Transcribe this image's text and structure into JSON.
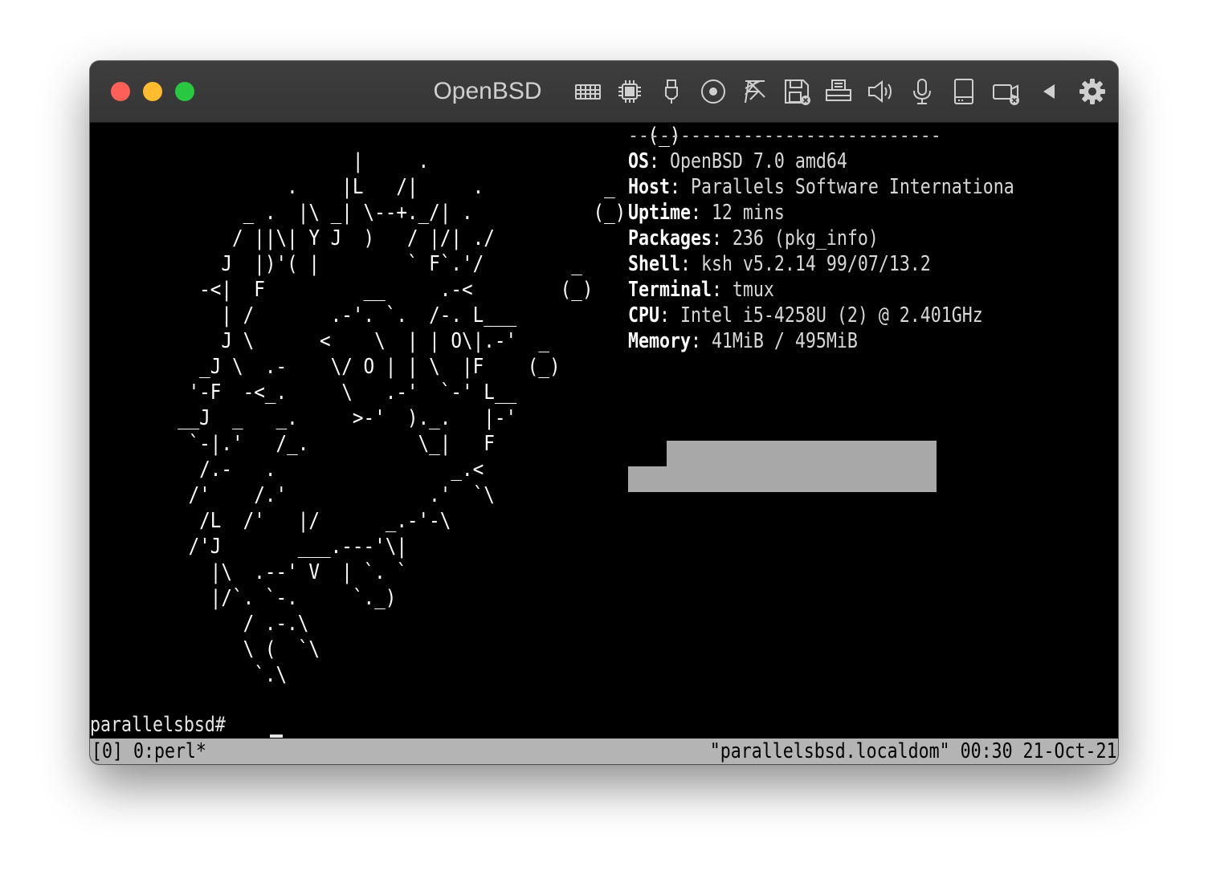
{
  "window": {
    "title": "OpenBSD",
    "traffic_lights": {
      "close": "#fe5f57",
      "minimize": "#febc2e",
      "zoom": "#28c840"
    }
  },
  "toolbar": {
    "icons": [
      "keyboard-icon",
      "cpu-icon",
      "usb-icon",
      "disc-icon",
      "network-icon",
      "floppy-icon",
      "printer-icon",
      "speaker-icon",
      "microphone-icon",
      "hard-drive-icon",
      "camera-icon",
      "collapse-arrow-icon",
      "gear-icon"
    ]
  },
  "terminal": {
    "ascii_art": "                                                   (_)\n                        |     .\n                  .    |L   /|     .           _\n              _ .  |\\ _| \\--+._/| .           (_)\n             / ||\\| Y J  )   / |/| ./\n            J  |)'( |        ` F`.'/        _\n          -<|  F         __     .-<        (_)\n            | /       .-'. `.  /-. L___\n            J \\      <    \\  | | O\\|.-'  _\n          _J \\  .-    \\/ O | | \\  |F    (_)\n         '-F  -<_.     \\   .-'  `-' L__\n        __J  _   _.     >-'  )._.   |-'\n         `-|.'   /_.          \\_|   F\n          /.-   .                _.<\n         /'    /.'             .'  `\\\n          /L  /'   |/      _.-'-\\\n         /'J       ___.---'\\|\n           |\\  .--' V  | `. `\n           |/`. `-.     `._)\n              / .-.\\\n              \\ (  `\\\n               `.\\",
    "sysinfo": {
      "separator": "------------------------------",
      "rows": [
        {
          "key": "OS",
          "value": "OpenBSD 7.0 amd64"
        },
        {
          "key": "Host",
          "value": "Parallels Software Internationa"
        },
        {
          "key": "Uptime",
          "value": "12 mins"
        },
        {
          "key": "Packages",
          "value": "236 (pkg_info)"
        },
        {
          "key": "Shell",
          "value": "ksh v5.2.14 99/07/13.2"
        },
        {
          "key": "Terminal",
          "value": "tmux"
        },
        {
          "key": "CPU",
          "value": "Intel i5-4258U (2) @ 2.401GHz"
        },
        {
          "key": "Memory",
          "value": "41MiB / 495MiB"
        }
      ]
    },
    "prompt": "parallelsbsd# ",
    "status_left": "[0] 0:perl*",
    "status_right": "\"parallelsbsd.localdom\" 00:30 21-Oct-21"
  }
}
